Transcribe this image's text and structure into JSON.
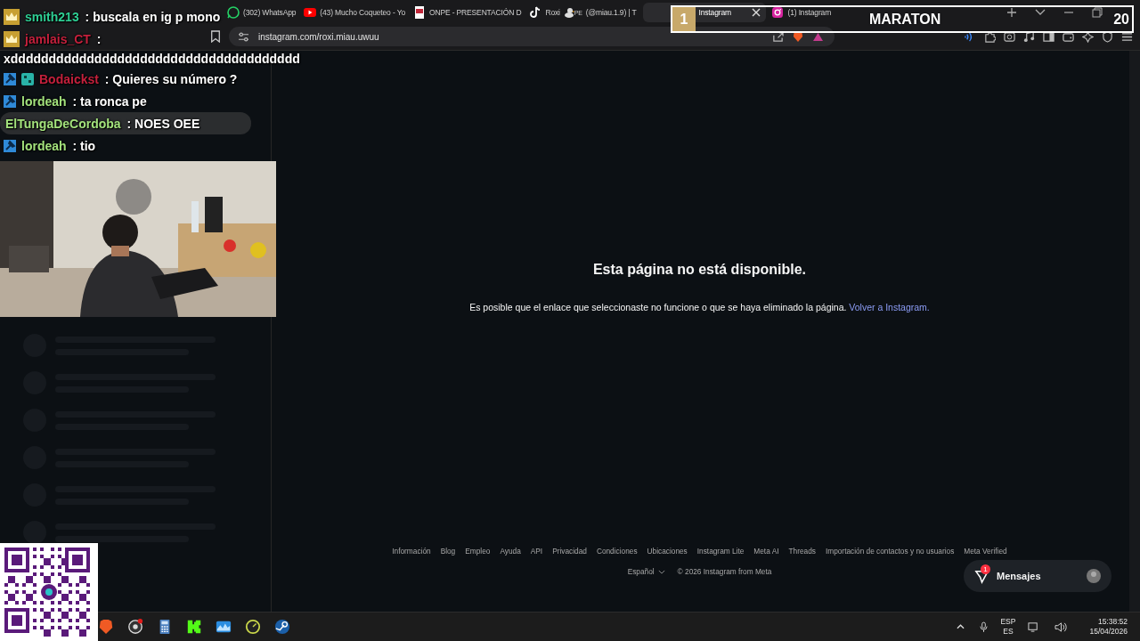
{
  "tabs": [
    {
      "title": "(302) WhatsApp",
      "kind": "whatsapp",
      "selected": false
    },
    {
      "title": "(43) Mucho Coqueteo - Yo",
      "kind": "youtube",
      "selected": false
    },
    {
      "title": "ONPE - PRESENTACIÓN D",
      "kind": "document",
      "selected": false
    },
    {
      "title": "Roxi",
      "flag": "PE",
      "suffix": "(@miau.1.9) | T",
      "kind": "tiktok",
      "selected": false
    },
    {
      "title": "Instagram",
      "selected": true
    },
    {
      "title": "(1) Instagram",
      "kind": "instagram",
      "selected": false
    }
  ],
  "address": {
    "url": "instagram.com/roxi.miau.uwuu"
  },
  "overlay_banner": {
    "number": "1",
    "title": "MARATON",
    "count": "20"
  },
  "chat": [
    {
      "kind": "crown",
      "user": "smith213",
      "color": "#2ecf94",
      "text": ": buscala en ig p mono"
    },
    {
      "kind": "crown",
      "user": "jamlais_CT",
      "color": "#c4203c",
      "text": ":"
    },
    {
      "kind": "plain",
      "text": "xdddddddddddddddddddddddddddddddddddddd"
    },
    {
      "kind": "moderator_subscriber",
      "user": "Bodaickst",
      "color": "#c4203c",
      "text": ": Quieres su número ?"
    },
    {
      "kind": "moderator",
      "user": "lordeah",
      "color": "#a3e27c",
      "text": ": ta ronca pe"
    },
    {
      "kind": "highlighted",
      "user": "ElTungaDeCordoba",
      "color": "#a3e27c",
      "text": ": NOES OEE"
    },
    {
      "kind": "moderator",
      "user": "lordeah",
      "color": "#a3e27c",
      "text": ": tio"
    }
  ],
  "page": {
    "heading": "Esta página no está disponible.",
    "message": "Es posible que el enlace que seleccionaste no funcione o que se haya eliminado la página.",
    "link": "Volver a Instagram."
  },
  "footer": {
    "links": [
      "Información",
      "Blog",
      "Empleo",
      "Ayuda",
      "API",
      "Privacidad",
      "Condiciones",
      "Ubicaciones",
      "Instagram Lite",
      "Meta AI",
      "Threads",
      "Importación de contactos y no usuarios",
      "Meta Verified"
    ],
    "language": "Español",
    "copyright": "© 2026 Instagram from Meta"
  },
  "messages_button": {
    "label": "Mensajes",
    "badge": "1"
  },
  "taskbar": {
    "language": "ESP",
    "layout": "ES",
    "time": "15:38:52",
    "date": "15/04/2026"
  }
}
